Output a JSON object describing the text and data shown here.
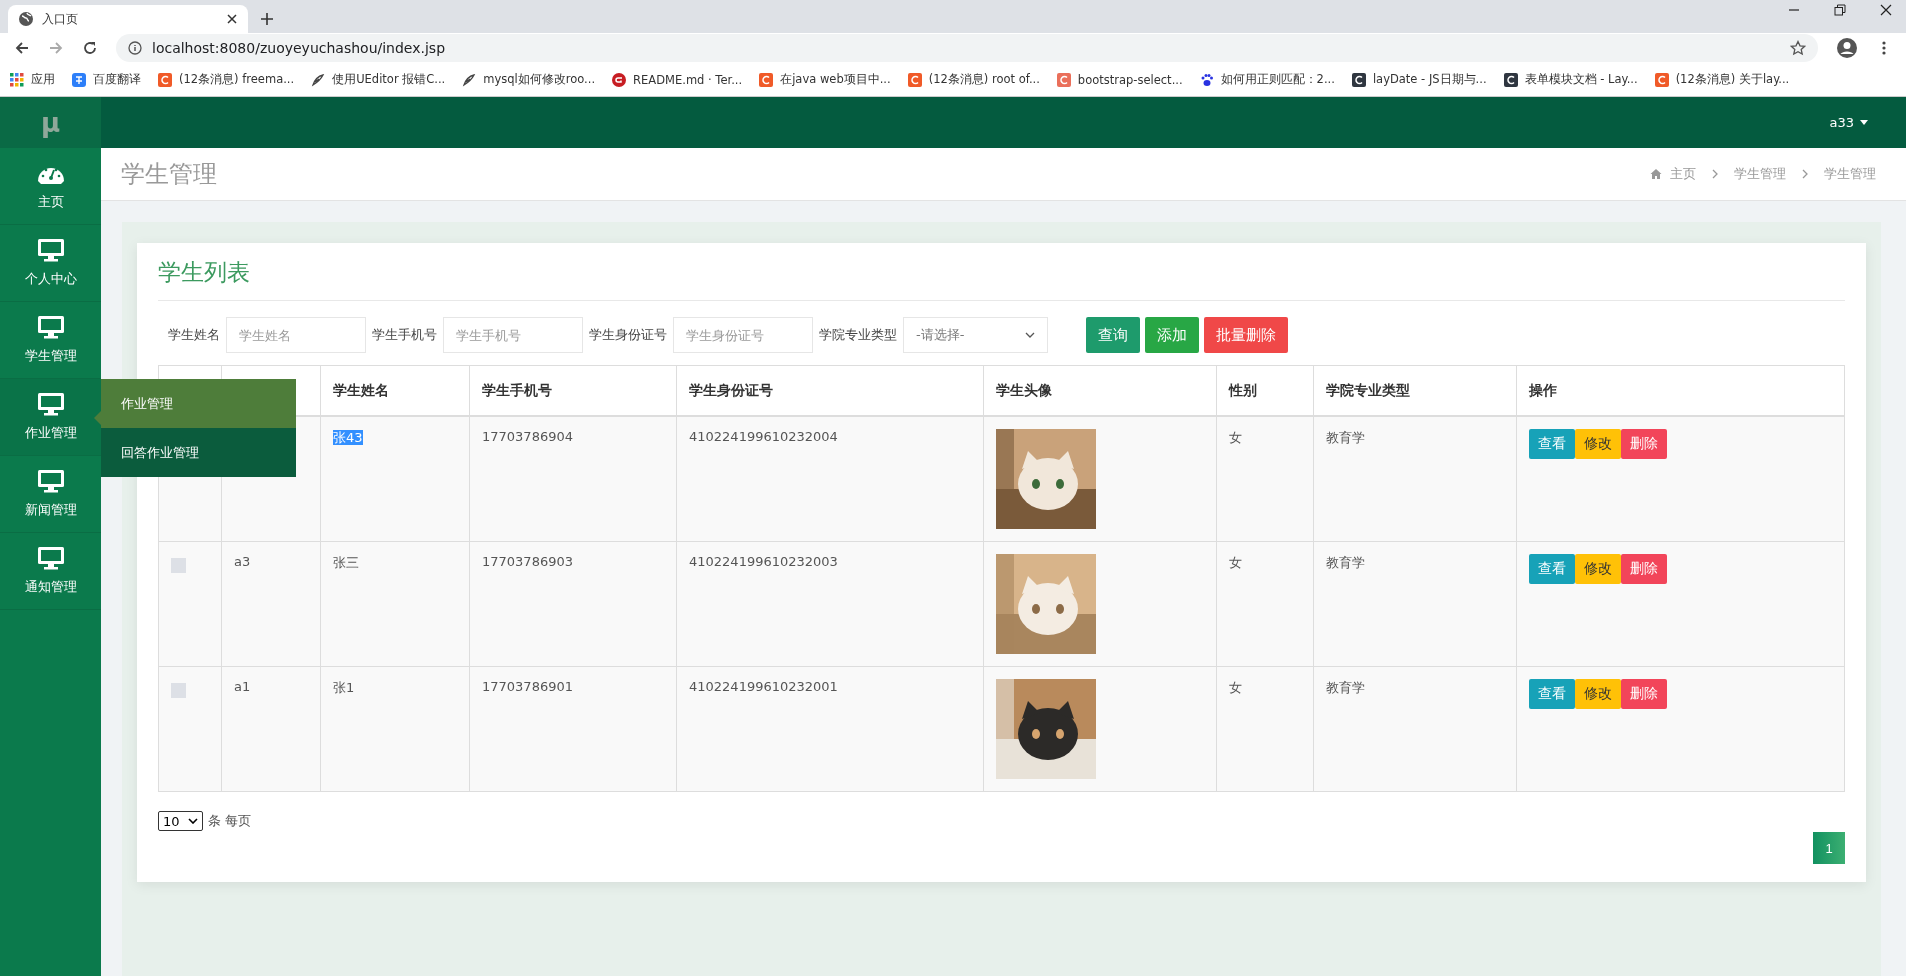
{
  "browser": {
    "tab_title": "入口页",
    "address": "localhost:8080/zuoyeyuchashou/index.jsp",
    "bookmarks": [
      {
        "label": "应用",
        "kind": "apps"
      },
      {
        "label": "百度翻译",
        "kind": "translate"
      },
      {
        "label": "(12条消息) freema...",
        "kind": "csdn"
      },
      {
        "label": "使用UEditor 报错C...",
        "kind": "feather"
      },
      {
        "label": "mysql如何修改roo...",
        "kind": "feather"
      },
      {
        "label": "README.md · Ter...",
        "kind": "gitee"
      },
      {
        "label": "在java web项目中...",
        "kind": "csdn"
      },
      {
        "label": "(12条消息) root of...",
        "kind": "csdn"
      },
      {
        "label": "bootstrap-select...",
        "kind": "jianshu"
      },
      {
        "label": "如何用正则匹配：2...",
        "kind": "paw"
      },
      {
        "label": "layDate - JS日期与...",
        "kind": "layui"
      },
      {
        "label": "表单模块文档 - Lay...",
        "kind": "layui"
      },
      {
        "label": "(12条消息) 关于lay...",
        "kind": "csdn"
      }
    ]
  },
  "app": {
    "logo": "μ",
    "user": "a33"
  },
  "sidebar": {
    "items": [
      {
        "label": "主页",
        "kind": "dashboard"
      },
      {
        "label": "个人中心",
        "kind": "monitor"
      },
      {
        "label": "学生管理",
        "kind": "monitor"
      },
      {
        "label": "作业管理",
        "kind": "monitor",
        "expanded": true,
        "children": [
          {
            "label": "作业管理",
            "selected": true
          },
          {
            "label": "回答作业管理",
            "selected": false
          }
        ]
      },
      {
        "label": "新闻管理",
        "kind": "monitor"
      },
      {
        "label": "通知管理",
        "kind": "monitor"
      }
    ]
  },
  "page": {
    "title": "学生管理",
    "breadcrumb": [
      "主页",
      "学生管理",
      "学生管理"
    ]
  },
  "card": {
    "title": "学生列表",
    "filters": [
      {
        "label": "学生姓名",
        "kind": "text",
        "placeholder": "学生姓名"
      },
      {
        "label": "学生手机号",
        "kind": "text",
        "placeholder": "学生手机号"
      },
      {
        "label": "学生身份证号",
        "kind": "text",
        "placeholder": "学生身份证号"
      },
      {
        "label": "学院专业类型",
        "kind": "select",
        "value": "-请选择-"
      }
    ],
    "buttons": [
      {
        "label": "查询",
        "kind": "search"
      },
      {
        "label": "添加",
        "kind": "add"
      },
      {
        "label": "批量删除",
        "kind": "delete"
      }
    ],
    "table": {
      "columns": [
        "学生姓名",
        "学生手机号",
        "学生身份证号",
        "学生头像",
        "性别",
        "学院专业类型",
        "操作"
      ],
      "rows": [
        {
          "name": "张43",
          "name_selected": true,
          "phone": "17703786904",
          "id_number": "410224199610232004",
          "gender": "女",
          "major": "教育学",
          "actions": [
            "查看",
            "修改",
            "删除"
          ]
        },
        {
          "checked": false,
          "account": "a3",
          "name": "张三",
          "name_selected": false,
          "phone": "17703786903",
          "id_number": "410224199610232003",
          "gender": "女",
          "major": "教育学",
          "actions": [
            "查看",
            "修改",
            "删除"
          ]
        },
        {
          "checked": false,
          "account": "a1",
          "name": "张1",
          "name_selected": false,
          "phone": "17703786901",
          "id_number": "410224199610232001",
          "gender": "女",
          "major": "教育学",
          "actions": [
            "查看",
            "修改",
            "删除"
          ]
        }
      ]
    },
    "page_size": "10",
    "page_size_label": "条 每页",
    "pages": [
      {
        "label": "1",
        "selected": true
      }
    ]
  }
}
